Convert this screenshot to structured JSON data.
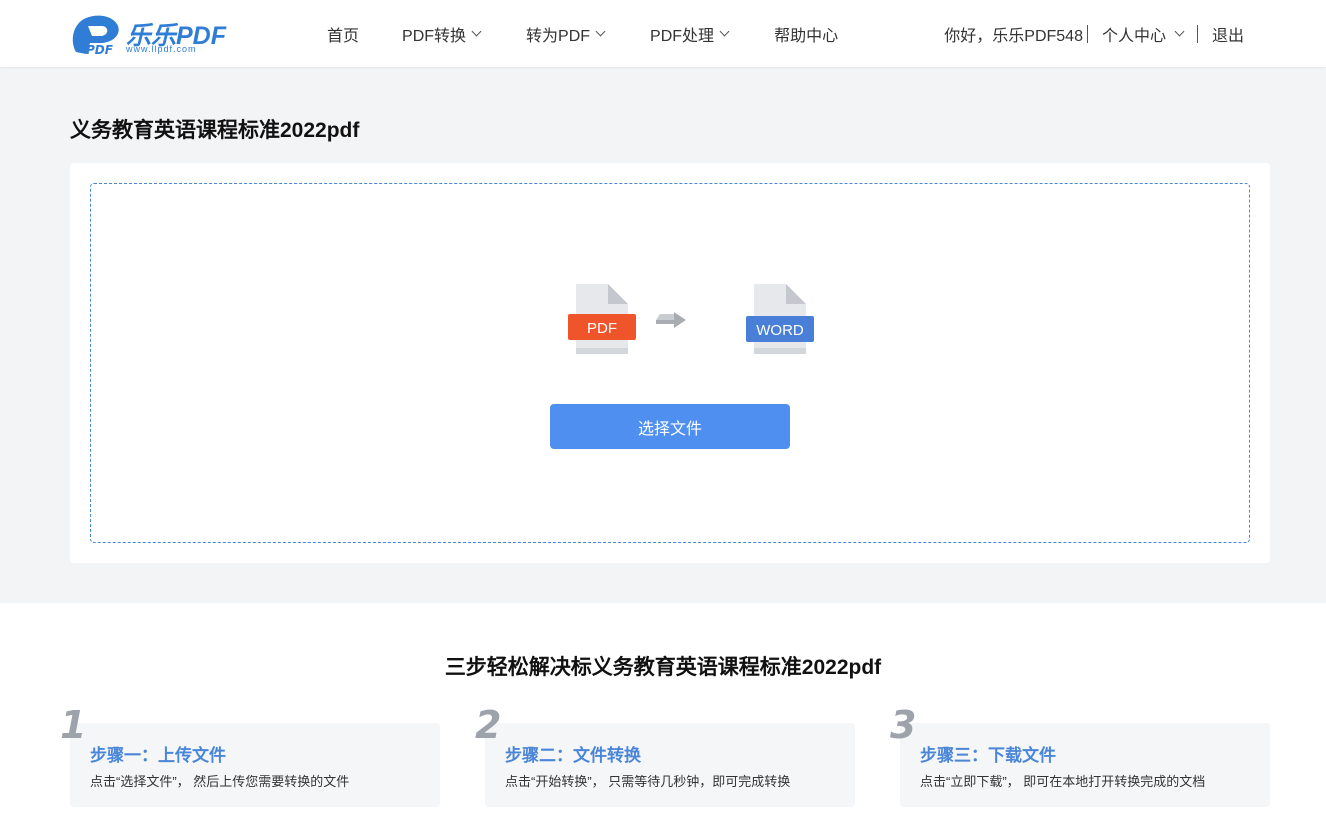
{
  "header": {
    "logo_text": "乐乐PDF",
    "logo_url": "www.llpdf.com",
    "logo_mark_letters": "PDF",
    "nav": [
      {
        "label": "首页",
        "dropdown": false
      },
      {
        "label": "PDF转换",
        "dropdown": true
      },
      {
        "label": "转为PDF",
        "dropdown": true
      },
      {
        "label": "PDF处理",
        "dropdown": true
      },
      {
        "label": "帮助中心",
        "dropdown": false
      }
    ],
    "greeting": "你好，乐乐PDF548",
    "user_center": "个人中心",
    "logout": "退出"
  },
  "page_title": "义务教育英语课程标准2022pdf",
  "upload": {
    "from_label": "PDF",
    "to_label": "WORD",
    "button_label": "选择文件"
  },
  "steps_title": "三步轻松解决标义务教育英语课程标准2022pdf",
  "steps": [
    {
      "num": "1",
      "title": "步骤一：上传文件",
      "desc": "点击“选择文件”， 然后上传您需要转换的文件"
    },
    {
      "num": "2",
      "title": "步骤二：文件转换",
      "desc": "点击“开始转换”， 只需等待几秒钟，即可完成转换"
    },
    {
      "num": "3",
      "title": "步骤三：下载文件",
      "desc": "点击“立即下载”， 即可在本地打开转换完成的文档"
    }
  ],
  "colors": {
    "brand": "#2f7dd4",
    "button": "#4f8ff0",
    "pdf_badge": "#f0542a",
    "word_badge": "#4a7fd8",
    "page_bg": "#f3f4f6"
  }
}
